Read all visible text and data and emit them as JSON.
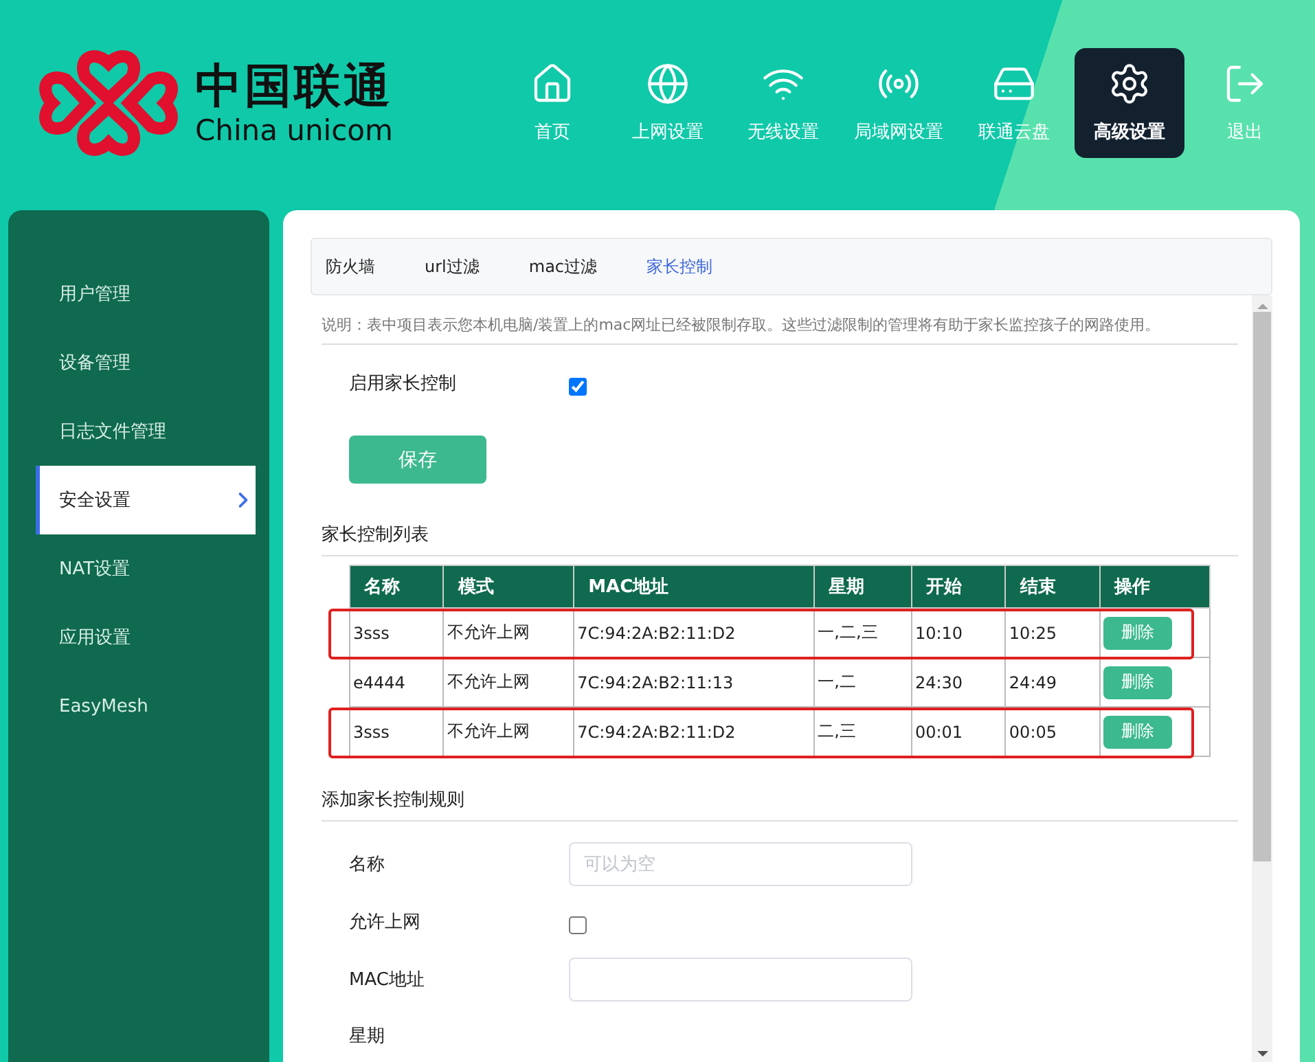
{
  "brand": {
    "name": "中国联通",
    "name_latin": "China unicom"
  },
  "nav": [
    {
      "label": "首页",
      "selected": false
    },
    {
      "label": "上网设置",
      "selected": false
    },
    {
      "label": "无线设置",
      "selected": false
    },
    {
      "label": "局域网设置",
      "selected": false
    },
    {
      "label": "联通云盘",
      "selected": false
    },
    {
      "label": "高级设置",
      "selected": true
    },
    {
      "label": "退出",
      "selected": false
    }
  ],
  "sidebar": {
    "items": [
      {
        "label": "用户管理",
        "selected": false
      },
      {
        "label": "设备管理",
        "selected": false
      },
      {
        "label": "日志文件管理",
        "selected": false
      },
      {
        "label": "安全设置",
        "selected": true
      },
      {
        "label": "NAT设置",
        "selected": false
      },
      {
        "label": "应用设置",
        "selected": false
      },
      {
        "label": "EasyMesh",
        "selected": false
      }
    ]
  },
  "tabs": [
    {
      "label": "防火墙",
      "selected": false
    },
    {
      "label": "url过滤",
      "selected": false
    },
    {
      "label": "mac过滤",
      "selected": false
    },
    {
      "label": "家长控制",
      "selected": true
    }
  ],
  "description": "说明：表中项目表示您本机电脑/装置上的mac网址已经被限制存取。这些过滤限制的管理将有助于家长监控孩子的网路使用。",
  "enable": {
    "label": "启用家长控制",
    "checked": true
  },
  "save_button": "保存",
  "list_title": "家长控制列表",
  "table": {
    "columns": [
      "名称",
      "模式",
      "MAC地址",
      "星期",
      "开始",
      "结束",
      "操作"
    ],
    "rows": [
      {
        "cells": [
          "3sss",
          "不允许上网",
          "7C:94:2A:B2:11:D2",
          "一,二,三",
          "10:10",
          "10:25"
        ],
        "action": "删除",
        "highlighted": true
      },
      {
        "cells": [
          "e4444",
          "不允许上网",
          "7C:94:2A:B2:11:13",
          "一,二",
          "24:30",
          "24:49"
        ],
        "action": "删除",
        "highlighted": false
      },
      {
        "cells": [
          "3sss",
          "不允许上网",
          "7C:94:2A:B2:11:D2",
          "二,三",
          "00:01",
          "00:05"
        ],
        "action": "删除",
        "highlighted": true
      }
    ]
  },
  "add_title": "添加家长控制规则",
  "form": [
    {
      "kind": "text",
      "label": "名称",
      "placeholder": "可以为空"
    },
    {
      "kind": "checkbox",
      "label": "允许上网",
      "checked": false
    },
    {
      "kind": "text",
      "label": "MAC地址"
    },
    {
      "kind": "label",
      "label": "星期"
    }
  ]
}
